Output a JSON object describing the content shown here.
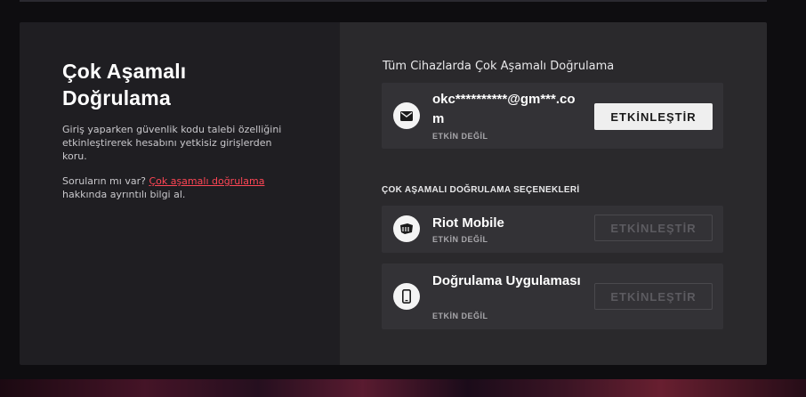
{
  "left_panel": {
    "title": "Çok Aşamalı Doğrulama",
    "description": "Giriş yaparken güvenlik kodu talebi özelliğini etkinleştirerek hesabını yetkisiz girişlerden koru.",
    "question_prefix": "Soruların mı var? ",
    "question_link": "Çok aşamalı doğrulama",
    "question_suffix": " hakkında ayrıntılı bilgi al."
  },
  "right_panel": {
    "section_title": "Tüm Cihazlarda Çok Aşamalı Doğrulama",
    "email_row": {
      "icon": "mail-icon",
      "name": "okc**********@gm***.com",
      "status": "ETKİN DEĞİL",
      "button_label": "ETKİNLEŞTİR"
    },
    "options_title": "ÇOK AŞAMALI DOĞRULAMA SEÇENEKLERİ",
    "options": [
      {
        "icon": "riot-fist-icon",
        "name": "Riot Mobile",
        "status": "ETKİN DEĞİL",
        "button_label": "ETKİNLEŞTİR"
      },
      {
        "icon": "phone-icon",
        "name": "Doğrulama Uygulaması",
        "status": "ETKİN DEĞİL",
        "button_label": "ETKİNLEŞTİR"
      }
    ]
  },
  "colors": {
    "accent_link": "#ff4655",
    "button_active_bg": "#efefef",
    "left_panel_bg": "#1f1e22",
    "right_panel_bg": "#2a292c",
    "row_bg": "#333236"
  }
}
